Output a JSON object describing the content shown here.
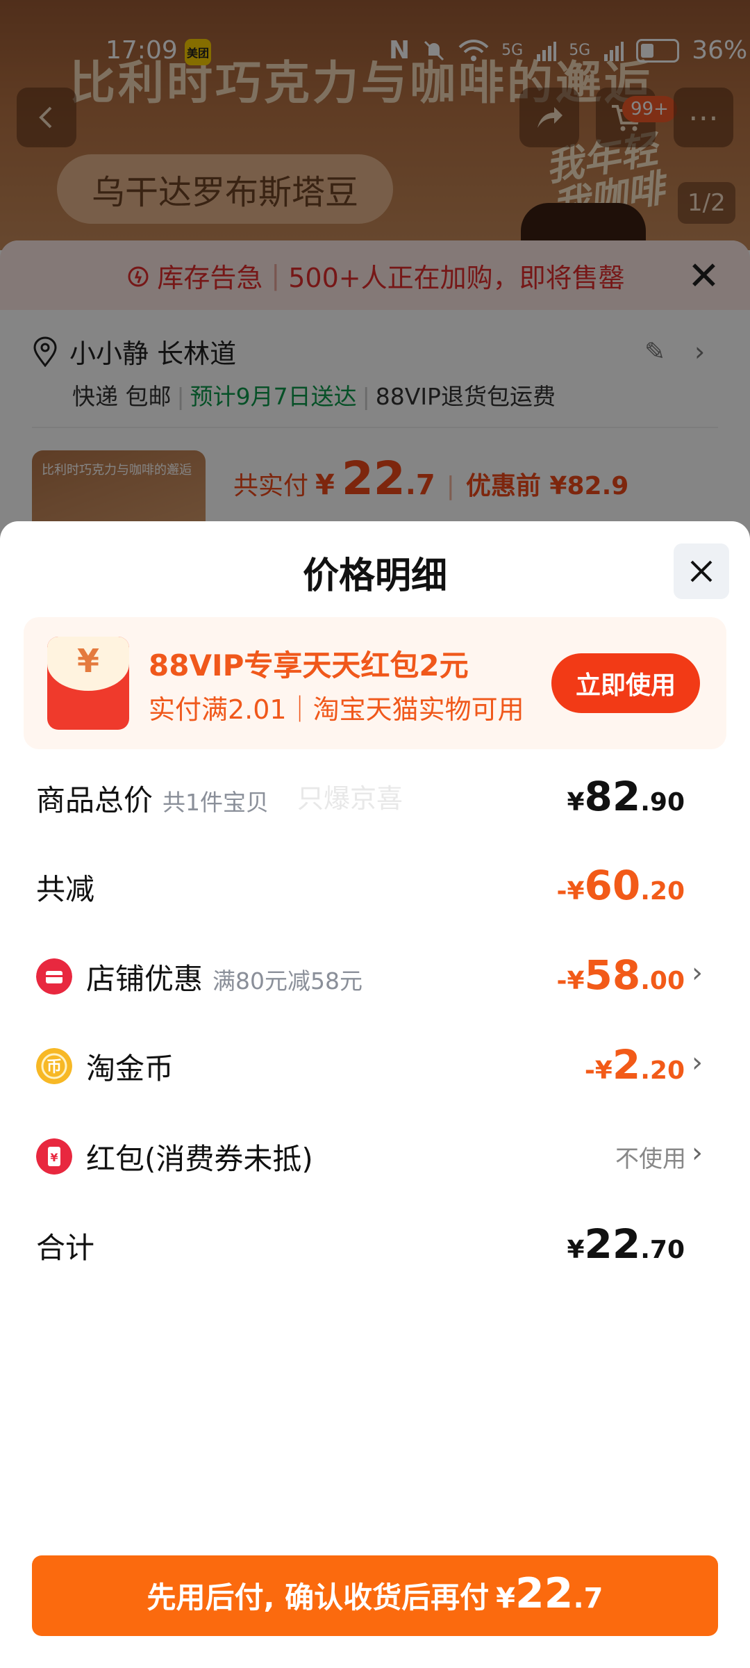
{
  "status_bar": {
    "time": "17:09",
    "app_badge": "美团",
    "battery": "36%",
    "signal_1": "5G",
    "signal_2": "5G"
  },
  "background_page": {
    "banner_text": "比利时巧克力与咖啡的邂逅",
    "product_tag": "乌干达罗布斯塔豆",
    "slogan_line1": "我年轻",
    "slogan_line2": "我咖啡",
    "cart_badge": "99+",
    "image_counter": "1/2",
    "stock_alert": {
      "title": "库存告急",
      "message": "500+人正在加购，即将售罄"
    },
    "address": {
      "name": "小小静 长林道",
      "shipping": "快递 包邮",
      "delivery": "预计9月7日送达",
      "vip_note": "88VIP退货包运费"
    },
    "thumb_text": "比利时巧克力与咖啡的邂逅",
    "price_summary": {
      "label": "共实付",
      "currency": "¥",
      "amount_int": "22",
      "amount_dec": ".7",
      "before_label": "优惠前 ¥82.9"
    }
  },
  "sheet": {
    "title": "价格明细",
    "promo": {
      "icon_symbol": "¥",
      "title": "88VIP专享天天红包2元",
      "subtitle": "实付满2.01｜淘宝天猫实物可用",
      "button": "立即使用"
    },
    "watermark": "只爆京喜",
    "rows": {
      "total": {
        "label": "商品总价",
        "sub": "共1件宝贝",
        "yen": "¥",
        "int": "82",
        "dec": ".90"
      },
      "reduce": {
        "label": "共减",
        "yen": "-¥",
        "int": "60",
        "dec": ".20"
      },
      "store": {
        "label": "店铺优惠",
        "sub": "满80元减58元",
        "yen": "-¥",
        "int": "58",
        "dec": ".00"
      },
      "coins": {
        "label": "淘金币",
        "yen": "-¥",
        "int": "2",
        "dec": ".20"
      },
      "redpacket": {
        "label": "红包(消费券未抵)",
        "value": "不使用"
      },
      "sum": {
        "label": "合计",
        "yen": "¥",
        "int": "22",
        "dec": ".70"
      }
    },
    "pay_button": {
      "text": "先用后付, 确认收货后再付",
      "yen": "¥",
      "int": "22",
      "dec": ".7"
    }
  },
  "colors": {
    "accent_orange": "#f25a18",
    "button_orange": "#fb6a0e",
    "promo_red": "#f23a16",
    "alert_red": "#e22c2c",
    "delivery_green": "#0d9a4b"
  }
}
